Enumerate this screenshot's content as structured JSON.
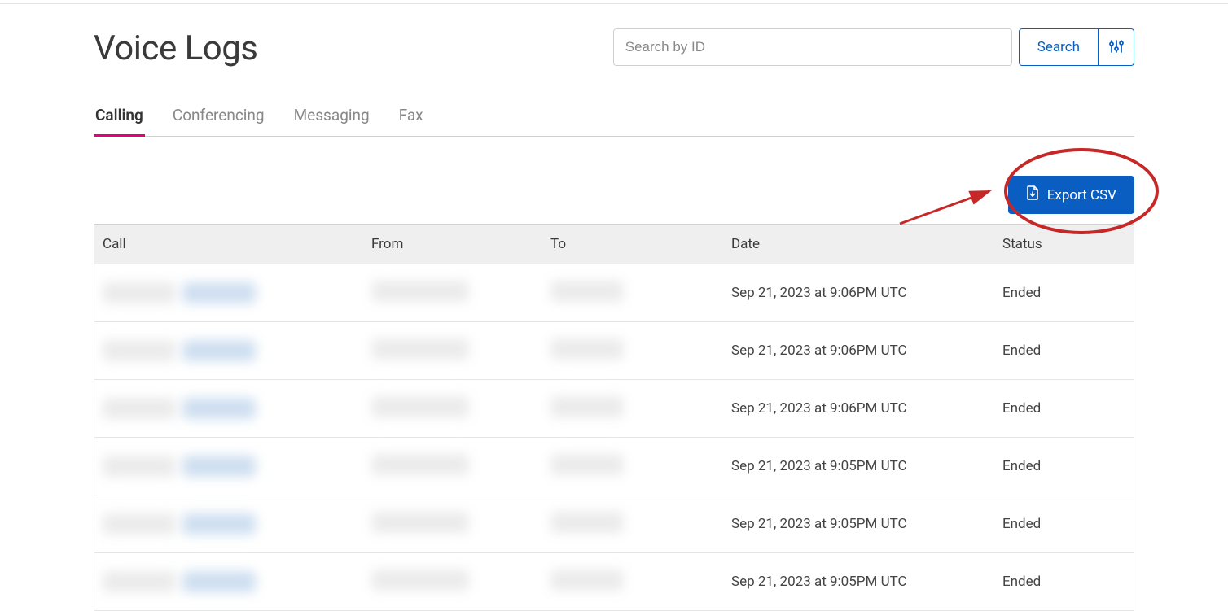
{
  "header": {
    "title": "Voice Logs"
  },
  "search": {
    "placeholder": "Search by ID",
    "button_label": "Search"
  },
  "tabs": [
    {
      "label": "Calling",
      "active": true
    },
    {
      "label": "Conferencing",
      "active": false
    },
    {
      "label": "Messaging",
      "active": false
    },
    {
      "label": "Fax",
      "active": false
    }
  ],
  "actions": {
    "export_label": "Export CSV"
  },
  "table": {
    "columns": {
      "call": "Call",
      "from": "From",
      "to": "To",
      "date": "Date",
      "status": "Status"
    },
    "rows": [
      {
        "date": "Sep 21, 2023 at 9:06PM UTC",
        "status": "Ended"
      },
      {
        "date": "Sep 21, 2023 at 9:06PM UTC",
        "status": "Ended"
      },
      {
        "date": "Sep 21, 2023 at 9:06PM UTC",
        "status": "Ended"
      },
      {
        "date": "Sep 21, 2023 at 9:05PM UTC",
        "status": "Ended"
      },
      {
        "date": "Sep 21, 2023 at 9:05PM UTC",
        "status": "Ended"
      },
      {
        "date": "Sep 21, 2023 at 9:05PM UTC",
        "status": "Ended"
      }
    ]
  }
}
